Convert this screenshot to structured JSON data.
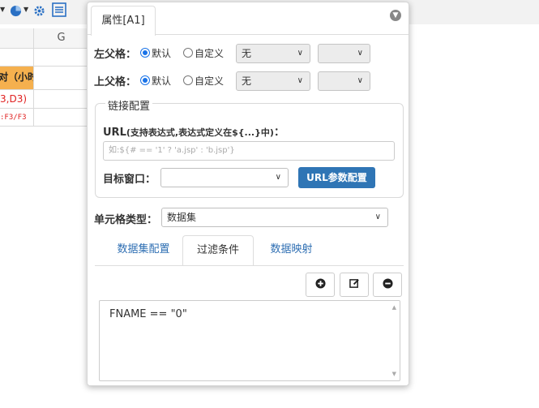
{
  "sheet": {
    "column_g": "G",
    "header_cell": "对（小时",
    "formula_cell": "3,D3)",
    "formula_small": ":F3/F3"
  },
  "panel": {
    "tab_title": "属性[A1]",
    "left_parent": {
      "label": "左父格：",
      "opt_default": "默认",
      "opt_custom": "自定义",
      "select_value": "无",
      "select2_value": ""
    },
    "top_parent": {
      "label": "上父格：",
      "opt_default": "默认",
      "opt_custom": "自定义",
      "select_value": "无",
      "select2_value": ""
    },
    "link": {
      "legend": "链接配置",
      "url_label": "URL",
      "url_hint": "(支持表达式,表达式定义在${...}中)",
      "url_colon": "：",
      "url_placeholder": "如:${# == '1' ? 'a.jsp' : 'b.jsp'}",
      "target_label": "目标窗口：",
      "target_value": "",
      "param_button": "URL参数配置"
    },
    "cell_type": {
      "label": "单元格类型：",
      "value": "数据集"
    },
    "sub_tabs": [
      "数据集配置",
      "过滤条件",
      "数据映射"
    ],
    "active_sub_tab": "过滤条件",
    "filter": {
      "text": "FNAME == \"0\""
    },
    "icons": [
      "plus-circle-icon",
      "edit-icon",
      "minus-circle-icon"
    ]
  },
  "colors": {
    "accent": "#1a73e8",
    "button_blue": "#2f75b5",
    "header_orange": "#f5b04e",
    "formula_red": "#e02020",
    "link_blue": "#2f6fb3"
  }
}
